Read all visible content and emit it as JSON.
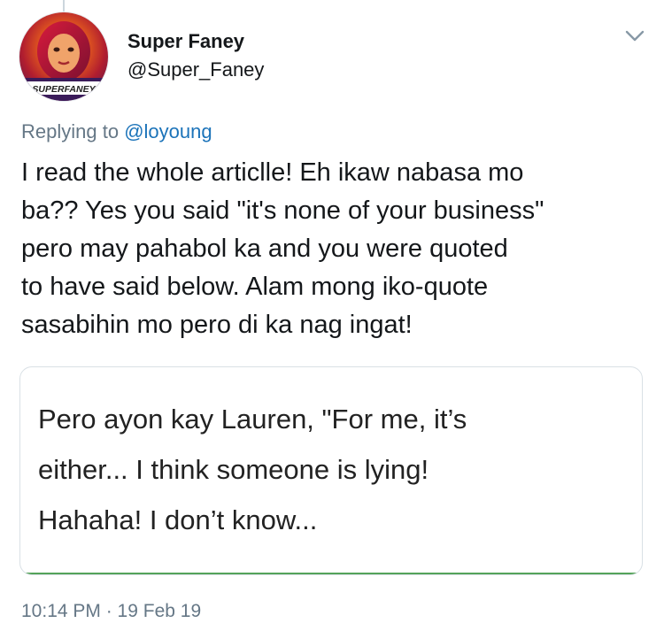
{
  "tweet": {
    "author_name": "Super Faney",
    "author_handle": "@Super_Faney",
    "avatar_label": "SUPERFANEY",
    "replying_prefix": "Replying to",
    "replying_to": "@loyoung",
    "text_lines": [
      "I read the whole articlle! Eh ikaw nabasa mo",
      "ba?? Yes you said \"it's none of your business\"",
      "pero may pahabol ka and you were quoted",
      "to have said below. Alam mong iko-quote",
      "sasabihin mo pero di ka nag ingat!"
    ],
    "media_text_lines": [
      "Pero ayon kay Lauren, \"For me, it’s",
      "either... I think someone is lying!",
      "Hahaha! I don’t know..."
    ],
    "timestamp": "10:14 PM · 19 Feb 19"
  },
  "icons": {
    "more": "chevron-down-icon"
  },
  "colors": {
    "link": "#1b73b9",
    "secondary_text": "#657786",
    "primary_text": "#14171a"
  }
}
